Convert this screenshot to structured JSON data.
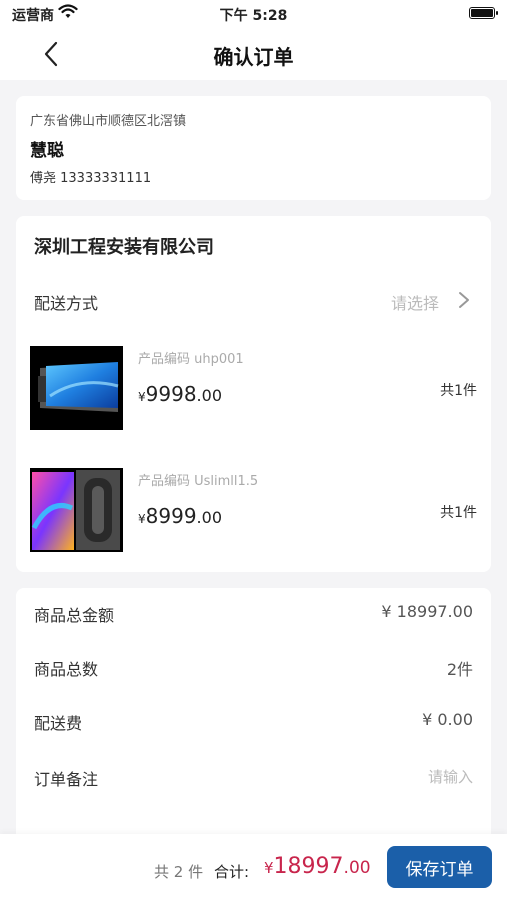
{
  "status_bar": {
    "carrier": "运营商",
    "time": "下午 5:28"
  },
  "nav": {
    "title": "确认订单"
  },
  "address": {
    "region": "广东省佛山市顺德区北滘镇",
    "name": "慧聪",
    "contact": "傅尧 13333331111"
  },
  "store": {
    "name": "深圳工程安装有限公司",
    "shipping_label": "配送方式",
    "shipping_placeholder": "请选择",
    "products": [
      {
        "sku": "产品编码 uhp001",
        "price_symbol": "¥",
        "price_int": "9998",
        "price_dec": ".00",
        "qty": "共1件"
      },
      {
        "sku": "产品编码 Uslimll1.5",
        "price_symbol": "¥",
        "price_int": "8999",
        "price_dec": ".00",
        "qty": "共1件"
      }
    ]
  },
  "summary": {
    "goods_total_label": "商品总金额",
    "goods_total_value": "¥ 18997.00",
    "goods_count_label": "商品总数",
    "goods_count_value": "2件",
    "shipping_fee_label": "配送费",
    "shipping_fee_value": "¥ 0.00",
    "note_label": "订单备注",
    "note_placeholder": "请输入"
  },
  "bottom": {
    "count": "共 2 件",
    "total_label": "合计:",
    "total_symbol": "¥",
    "total_int": "18997",
    "total_dec": ".00",
    "save_label": "保存订单"
  },
  "colors": {
    "accent_blue": "#1b5fa9",
    "price_red": "#c8254c"
  }
}
